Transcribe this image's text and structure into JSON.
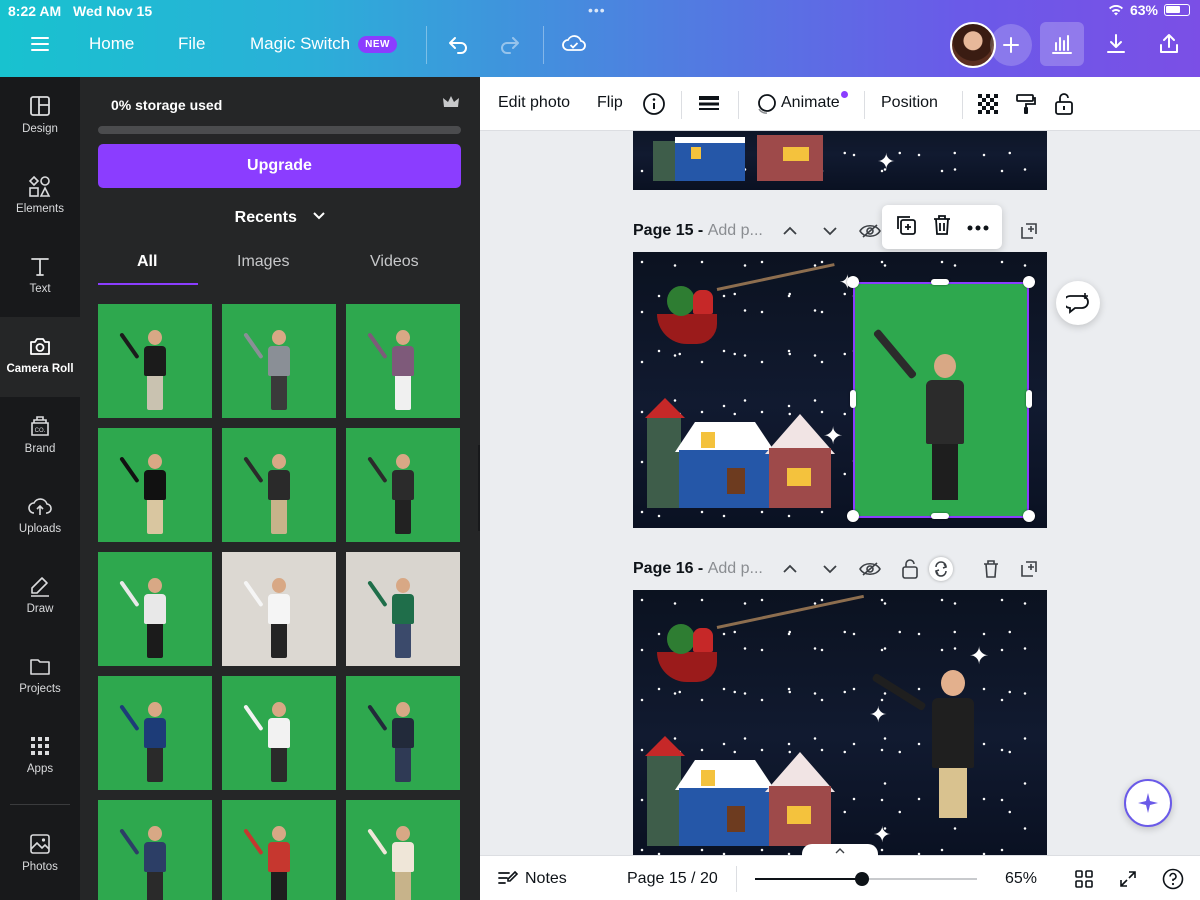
{
  "status": {
    "time": "8:22 AM",
    "date": "Wed Nov 15",
    "battery": "63%"
  },
  "topbar": {
    "home": "Home",
    "file": "File",
    "magic_switch": "Magic Switch",
    "new_badge": "NEW"
  },
  "sidebar": {
    "items": [
      {
        "label": "Design",
        "icon": "layout-icon"
      },
      {
        "label": "Elements",
        "icon": "shapes-icon"
      },
      {
        "label": "Text",
        "icon": "text-icon"
      },
      {
        "label": "Camera Roll",
        "icon": "camera-icon",
        "active": true
      },
      {
        "label": "Brand",
        "icon": "brand-icon"
      },
      {
        "label": "Uploads",
        "icon": "cloud-upload-icon"
      },
      {
        "label": "Draw",
        "icon": "draw-icon"
      },
      {
        "label": "Projects",
        "icon": "folder-icon"
      },
      {
        "label": "Apps",
        "icon": "apps-icon"
      },
      {
        "label": "Photos",
        "icon": "photo-icon"
      }
    ]
  },
  "panel": {
    "storage": "0% storage used",
    "storage_fraction": 0,
    "upgrade": "Upgrade",
    "recents": "Recents",
    "tabs": [
      "All",
      "Images",
      "Videos"
    ],
    "active_tab": "All"
  },
  "toolbar": {
    "edit_photo": "Edit photo",
    "flip": "Flip",
    "animate": "Animate",
    "position": "Position"
  },
  "pages": [
    {
      "title": "Page 15 -",
      "add": "Add p..."
    },
    {
      "title": "Page 16 -",
      "add": "Add p..."
    }
  ],
  "bottombar": {
    "notes": "Notes",
    "page_indicator": "Page 15 / 20",
    "zoom": "65%",
    "zoom_fraction": 0.48
  },
  "colors": {
    "accent": "#8b3dff",
    "panel_bg": "#252627",
    "sidebar_bg": "#18191b",
    "greenscreen": "#2ea84e"
  }
}
